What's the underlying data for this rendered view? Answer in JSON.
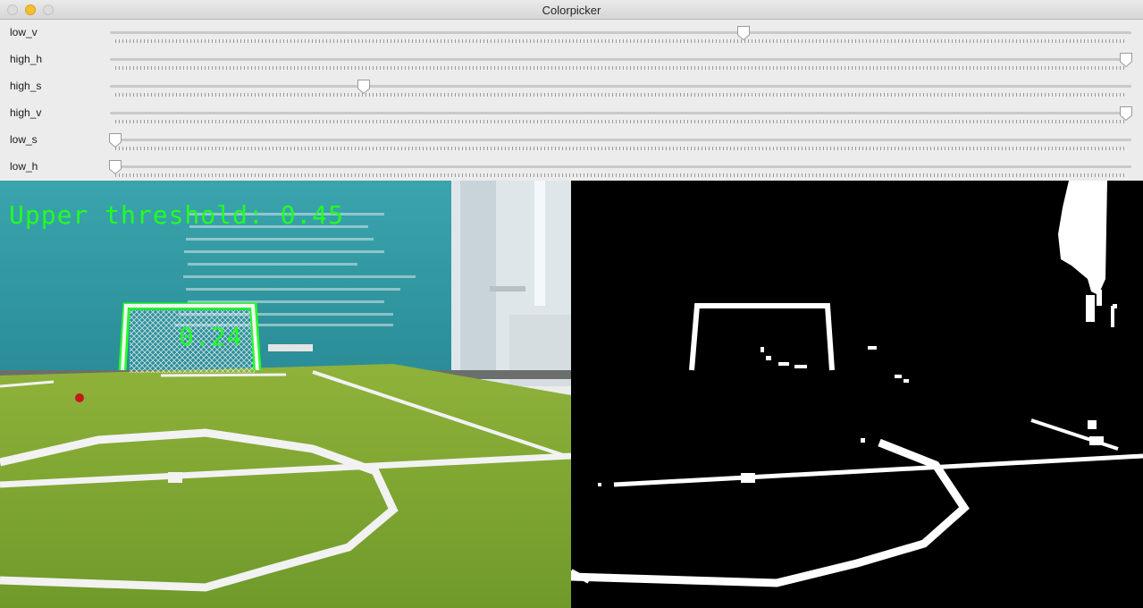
{
  "window": {
    "title": "Colorpicker"
  },
  "sliders": [
    {
      "label": "low_v",
      "fraction": 0.622
    },
    {
      "label": "high_h",
      "fraction": 1.0
    },
    {
      "label": "high_s",
      "fraction": 0.246
    },
    {
      "label": "high_v",
      "fraction": 1.0
    },
    {
      "label": "low_s",
      "fraction": 0.0
    },
    {
      "label": "low_h",
      "fraction": 0.0
    }
  ],
  "camera_view": {
    "upper_threshold_text": "Upper threshold: 0.45",
    "goal_confidence_text": "0.24",
    "overlay_color": "#22ff22"
  },
  "mask_view": {
    "background_color": "#000000",
    "foreground_color": "#ffffff"
  }
}
